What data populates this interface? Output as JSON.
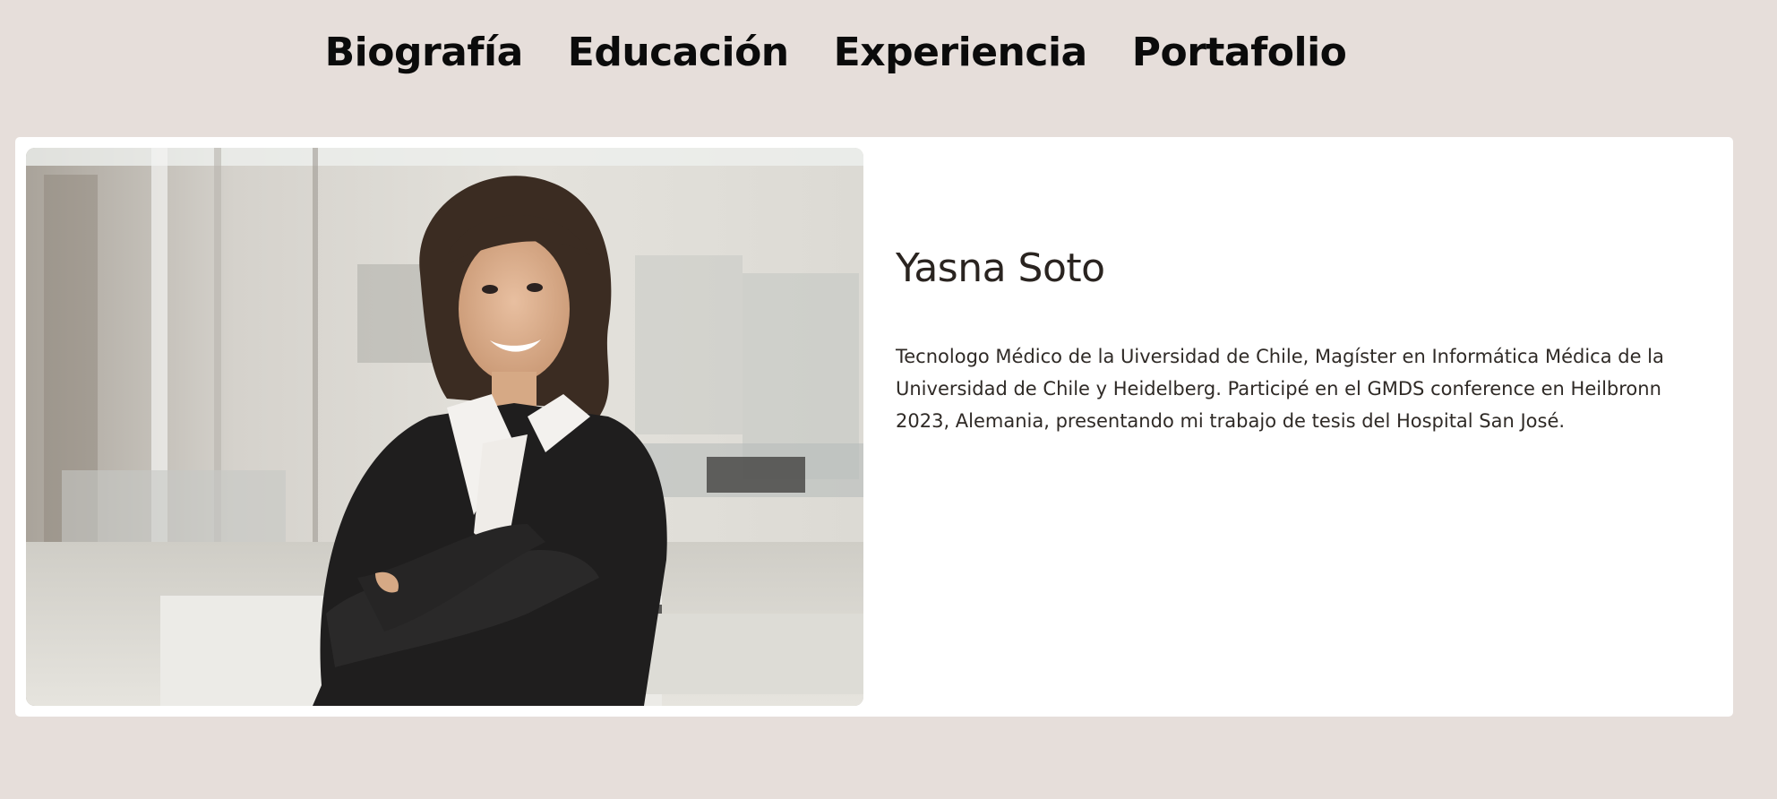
{
  "nav": {
    "items": [
      {
        "label": "Biografía"
      },
      {
        "label": "Educación"
      },
      {
        "label": "Experiencia"
      },
      {
        "label": "Portafolio"
      }
    ]
  },
  "profile": {
    "photo_description_icon": "person-photo",
    "name": "Yasna Soto",
    "bio": "Tecnologo Médico de la Uiversidad de Chile, Magíster en Informática Médica de la Universidad de Chile y Heidelberg. Participé en el GMDS conference en Heilbronn 2023, Alemania, presentando mi trabajo de tesis del Hospital San José."
  },
  "colors": {
    "page_background": "#e6deda",
    "card_background": "#ffffff",
    "nav_text": "#0b0b0b",
    "body_text": "#2f2a26"
  }
}
